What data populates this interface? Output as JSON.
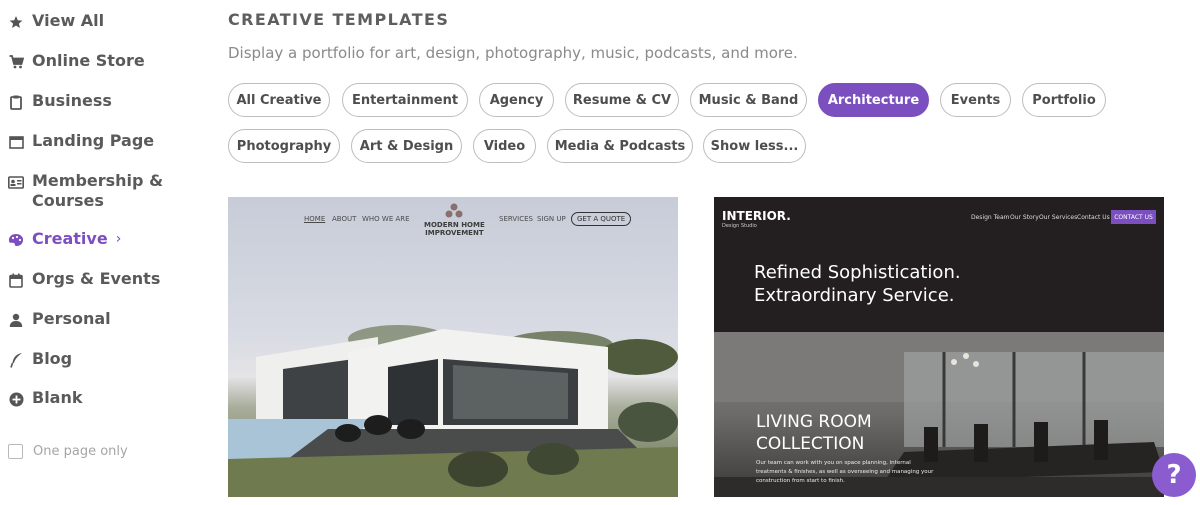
{
  "sidebar": {
    "items": [
      {
        "label": "View All",
        "icon": "star-icon"
      },
      {
        "label": "Online Store",
        "icon": "cart-icon"
      },
      {
        "label": "Business",
        "icon": "clipboard-icon"
      },
      {
        "label": "Landing Page",
        "icon": "window-icon"
      },
      {
        "label": "Membership & Courses",
        "icon": "id-card-icon"
      },
      {
        "label": "Creative",
        "icon": "palette-icon",
        "active": true
      },
      {
        "label": "Orgs & Events",
        "icon": "calendar-icon"
      },
      {
        "label": "Personal",
        "icon": "person-icon"
      },
      {
        "label": "Blog",
        "icon": "quill-icon"
      },
      {
        "label": "Blank",
        "icon": "plus-circle-icon"
      }
    ],
    "chevron": "›",
    "one_page_only": "One page only"
  },
  "main": {
    "heading": "CREATIVE TEMPLATES",
    "subtitle": "Display a portfolio for art, design, photography, music, podcasts, and more.",
    "filters": [
      "All Creative",
      "Entertainment",
      "Agency",
      "Resume & CV",
      "Music & Band",
      "Architecture",
      "Events",
      "Portfolio",
      "Photography",
      "Art & Design",
      "Video",
      "Media & Podcasts",
      "Show less..."
    ],
    "active_filter": "Architecture"
  },
  "template1": {
    "nav_left": [
      "HOME",
      "ABOUT",
      "WHO WE ARE"
    ],
    "logo_line1": "MODERN HOME",
    "logo_line2": "IMPROVEMENT",
    "nav_right": [
      "SERVICES",
      "SIGN UP"
    ],
    "cta": "GET A QUOTE"
  },
  "template2": {
    "brand": "INTERIOR.",
    "brand_sub": "Design Studio",
    "nav": [
      "Design Team",
      "Our Story",
      "Our Services",
      "Contact Us"
    ],
    "cta": "CONTACT US",
    "headline_line1": "Refined Sophistication.",
    "headline_line2": "Extraordinary Service.",
    "collection_line1": "LIVING ROOM",
    "collection_line2": "COLLECTION",
    "body": "Our team can work with you on space planning, internal treatments & finishes, as well as overseeing and managing your construction from start to finish."
  },
  "help": {
    "label": "?"
  },
  "colors": {
    "accent": "#7b4fc0"
  }
}
